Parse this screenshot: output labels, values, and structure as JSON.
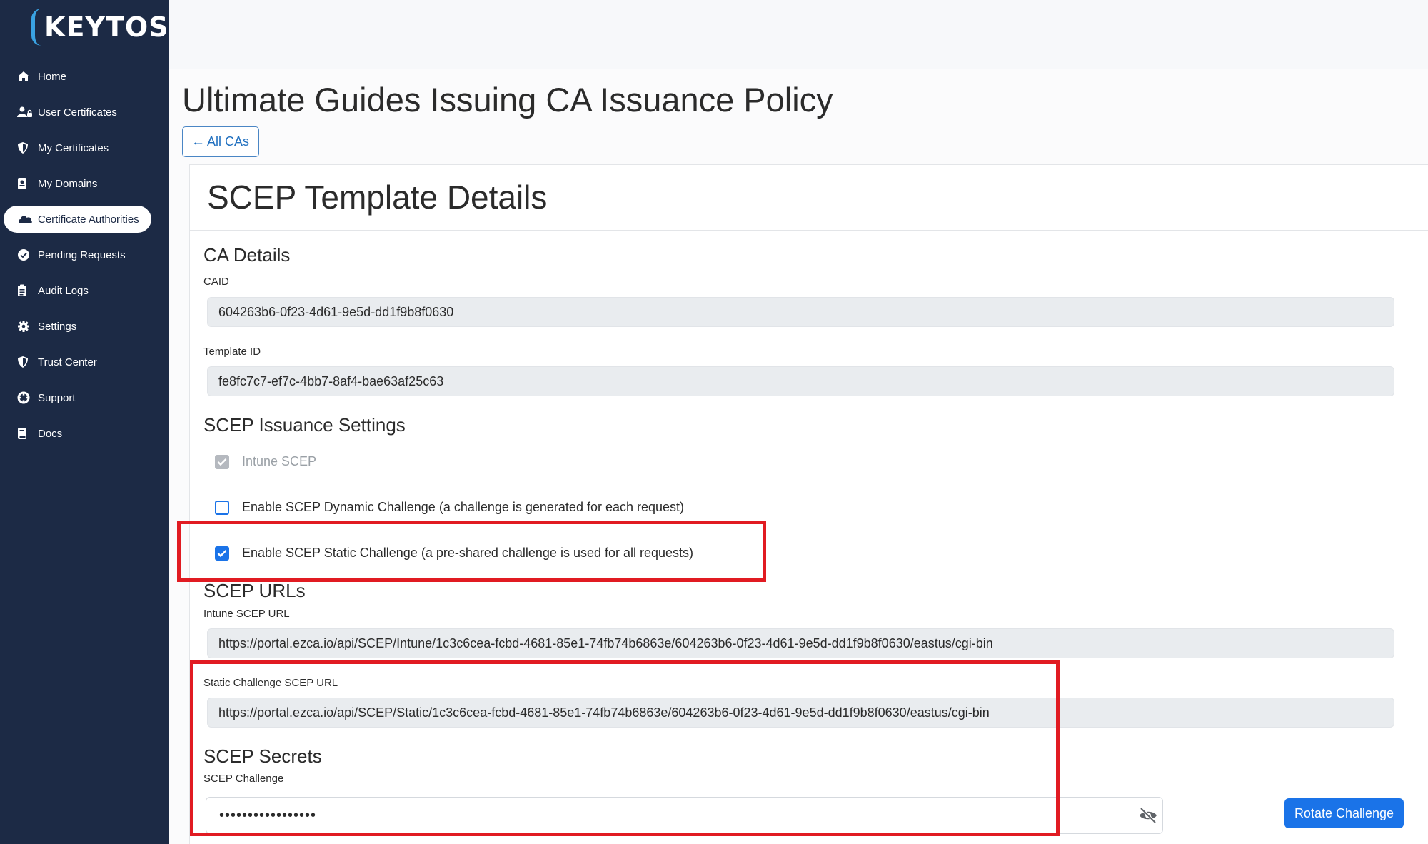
{
  "app": {
    "logo_text": "KEYTOS"
  },
  "sidebar": {
    "items": [
      {
        "label": "Home",
        "icon": "home-icon"
      },
      {
        "label": "User Certificates",
        "icon": "user-lock-icon"
      },
      {
        "label": "My Certificates",
        "icon": "shield-icon"
      },
      {
        "label": "My Domains",
        "icon": "id-badge-icon"
      },
      {
        "label": "Certificate Authorities",
        "icon": "cloud-icon",
        "active": true
      },
      {
        "label": "Pending Requests",
        "icon": "check-circle-icon"
      },
      {
        "label": "Audit Logs",
        "icon": "clipboard-icon"
      },
      {
        "label": "Settings",
        "icon": "gear-icon"
      },
      {
        "label": "Trust Center",
        "icon": "shield-icon"
      },
      {
        "label": "Support",
        "icon": "life-ring-icon"
      },
      {
        "label": "Docs",
        "icon": "book-icon"
      }
    ]
  },
  "page": {
    "title": "Ultimate Guides Issuing CA Issuance Policy",
    "back_button": "All CAs"
  },
  "card": {
    "title": "SCEP Template Details",
    "ca_details": {
      "heading": "CA Details",
      "caid_label": "CAID",
      "caid_value": "604263b6-0f23-4d61-9e5d-dd1f9b8f0630",
      "template_label": "Template ID",
      "template_value": "fe8fc7c7-ef7c-4bb7-8af4-bae63af25c63"
    },
    "issuance": {
      "heading": "SCEP Issuance Settings",
      "intune_label": "Intune SCEP",
      "intune_checked": true,
      "dynamic_label": "Enable SCEP Dynamic Challenge (a challenge is generated for each request)",
      "dynamic_checked": false,
      "static_label": "Enable SCEP Static Challenge (a pre-shared challenge is used for all requests)",
      "static_checked": true
    },
    "urls": {
      "heading": "SCEP URLs",
      "intune_label": "Intune SCEP URL",
      "intune_value": "https://portal.ezca.io/api/SCEP/Intune/1c3c6cea-fcbd-4681-85e1-74fb74b6863e/604263b6-0f23-4d61-9e5d-dd1f9b8f0630/eastus/cgi-bin",
      "static_label": "Static Challenge SCEP URL",
      "static_value": "https://portal.ezca.io/api/SCEP/Static/1c3c6cea-fcbd-4681-85e1-74fb74b6863e/604263b6-0f23-4d61-9e5d-dd1f9b8f0630/eastus/cgi-bin"
    },
    "secrets": {
      "heading": "SCEP Secrets",
      "challenge_label": "SCEP Challenge",
      "challenge_value": "•••••••••••••••••",
      "rotate_button": "Rotate Challenge"
    }
  },
  "colors": {
    "sidebar_bg": "#1c2a45",
    "accent": "#1a73e8",
    "highlight_red": "#e11b22",
    "logo_accent": "#3aa3e3"
  }
}
